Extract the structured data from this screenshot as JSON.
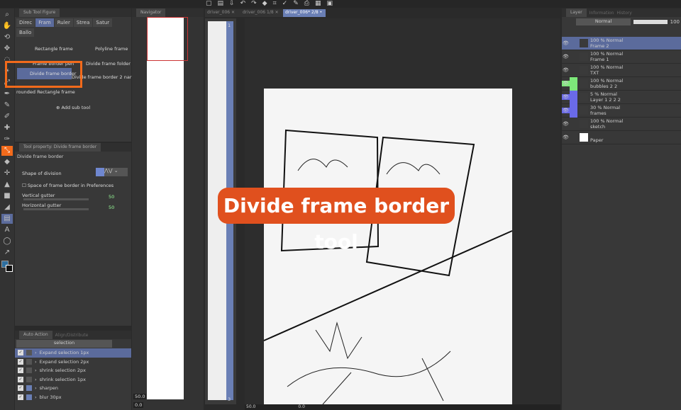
{
  "subtool": {
    "panel_title": "Sub Tool Figure",
    "tabs": [
      "Direc",
      "Fram",
      "Ruler",
      "Strea",
      "Satur",
      "Ballo"
    ],
    "items": [
      "Rectangle frame",
      "Polyline frame",
      "Frame border pen",
      "Divide frame folder",
      "Divide frame border",
      "Divide frame border 2 nar",
      "rounded Rectangle frame"
    ],
    "add_label": "Add sub tool"
  },
  "toolprop": {
    "panel_title": "Tool property: Divide frame border",
    "tool_name": "Divide frame border",
    "shape_label": "Shape of division",
    "space_label": "Space of frame border in Preferences",
    "vertical_label": "Vertical gutter",
    "vertical_value": "50",
    "horizontal_label": "Horizontal gutter",
    "horizontal_value": "50"
  },
  "autoaction": {
    "tab1": "Auto Action",
    "tab2": "Align/Distribute",
    "set": "selection",
    "items": [
      "Expand selection 1px",
      "Expand selection 2px",
      "shrink selection 2px",
      "shrink selection 1px",
      "sharpen",
      "blur 30px"
    ]
  },
  "navigator": {
    "title": "Navigator",
    "zoom": "50.0",
    "angle": "0.0"
  },
  "doc_tabs": [
    {
      "name": "driver_006",
      "page": ""
    },
    {
      "name": "driver_006",
      "page": "1/8"
    },
    {
      "name": "driver_006*",
      "page": "2/8"
    }
  ],
  "pagelist": {
    "first": "1",
    "last": "3"
  },
  "canvas_status": {
    "zoom": "50.0",
    "angle": "0.0"
  },
  "banner": {
    "text": "Divide frame border tool",
    "color": "#e0501e"
  },
  "layer": {
    "tabs": [
      "Layer",
      "Information",
      "History"
    ],
    "blend": "Normal",
    "opacity": "100",
    "rows": [
      {
        "mode": "100 % Normal",
        "name": "Frame 2"
      },
      {
        "mode": "100 % Normal",
        "name": "Frame 1"
      },
      {
        "mode": "100 % Normal",
        "name": "TXT"
      },
      {
        "mode": "100 % Normal",
        "name": "bubbles 2 2"
      },
      {
        "mode": "5 % Normal",
        "name": "Layer 1 2 2 2"
      },
      {
        "mode": "30 % Normal",
        "name": "frames"
      },
      {
        "mode": "100 % Normal",
        "name": "sketch"
      },
      {
        "mode": "",
        "name": "Paper"
      }
    ]
  },
  "colors": {
    "accent": "#f26a1b",
    "selection": "#5b6b9c",
    "green_tag": "#7de87a",
    "blue_tag": "#6a6ae8"
  }
}
